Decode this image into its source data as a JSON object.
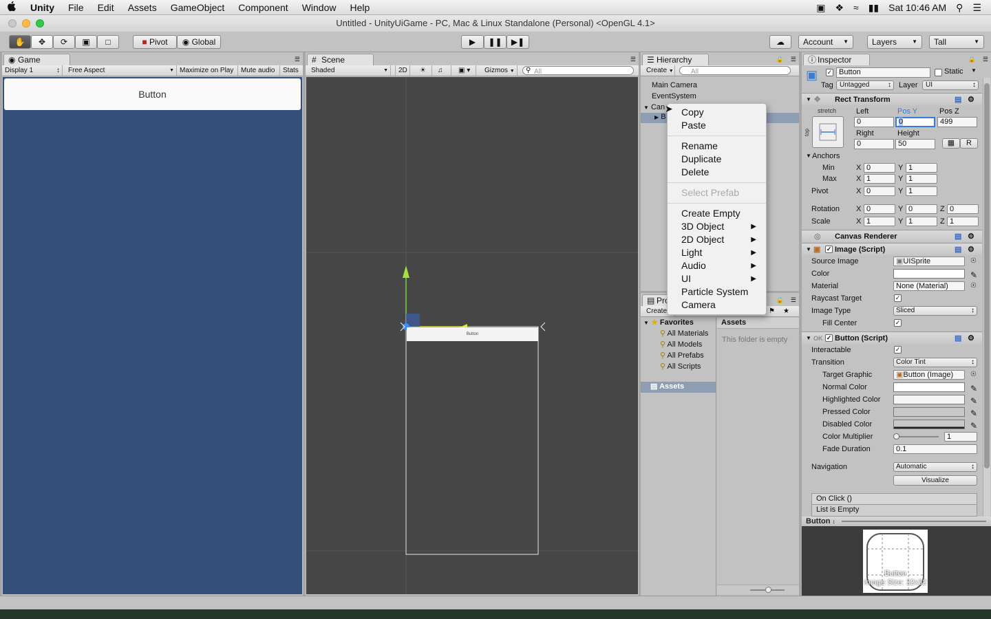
{
  "menubar": {
    "apple": "",
    "items": [
      "Unity",
      "File",
      "Edit",
      "Assets",
      "GameObject",
      "Component",
      "Window",
      "Help"
    ],
    "clock": "Sat 10:46 AM"
  },
  "window": {
    "title": "Untitled - UnityUiGame - PC, Mac & Linux Standalone (Personal) <OpenGL 4.1>"
  },
  "toolbar": {
    "pivot": "Pivot",
    "global": "Global",
    "account": "Account",
    "layers": "Layers",
    "layout": "Tall"
  },
  "game": {
    "tab": "Game",
    "display": "Display 1",
    "aspect": "Free Aspect",
    "maximize": "Maximize on Play",
    "mute": "Mute audio",
    "stats": "Stats",
    "button_label": "Button",
    "canvas_color": "#344f79"
  },
  "scene": {
    "tab": "Scene",
    "shading": "Shaded",
    "mode2d": "2D",
    "gizmos": "Gizmos",
    "search_placeholder": "All",
    "button_label": "Button"
  },
  "hierarchy": {
    "tab": "Hierarchy",
    "create": "Create",
    "search_placeholder": "All",
    "items": [
      "Main Camera",
      "EventSystem",
      "Can",
      "B"
    ]
  },
  "context_menu": {
    "items": [
      {
        "label": "Copy",
        "enabled": true,
        "submenu": false
      },
      {
        "label": "Paste",
        "enabled": true,
        "submenu": false
      },
      {
        "label": "Rename",
        "enabled": true,
        "submenu": false
      },
      {
        "label": "Duplicate",
        "enabled": true,
        "submenu": false
      },
      {
        "label": "Delete",
        "enabled": true,
        "submenu": false
      },
      {
        "label": "Select Prefab",
        "enabled": false,
        "submenu": false
      },
      {
        "label": "Create Empty",
        "enabled": true,
        "submenu": false
      },
      {
        "label": "3D Object",
        "enabled": true,
        "submenu": true
      },
      {
        "label": "2D Object",
        "enabled": true,
        "submenu": true
      },
      {
        "label": "Light",
        "enabled": true,
        "submenu": true
      },
      {
        "label": "Audio",
        "enabled": true,
        "submenu": true
      },
      {
        "label": "UI",
        "enabled": true,
        "submenu": true
      },
      {
        "label": "Particle System",
        "enabled": true,
        "submenu": false
      },
      {
        "label": "Camera",
        "enabled": true,
        "submenu": false
      }
    ]
  },
  "project": {
    "tab": "Pro",
    "create": "Create",
    "favorites": "Favorites",
    "fav_items": [
      "All Materials",
      "All Models",
      "All Prefabs",
      "All Scripts"
    ],
    "assets": "Assets",
    "assets_header": "Assets",
    "empty": "This folder is empty"
  },
  "inspector": {
    "tab": "Inspector",
    "object_name": "Button",
    "static": "Static",
    "tag_label": "Tag",
    "tag": "Untagged",
    "layer_label": "Layer",
    "layer": "UI",
    "rect": {
      "title": "Rect Transform",
      "stretch": "stretch",
      "top": "top",
      "left_label": "Left",
      "posy_label": "Pos Y",
      "posz_label": "Pos Z",
      "left": "0",
      "posy": "0",
      "posz": "499",
      "right_label": "Right",
      "height_label": "Height",
      "right": "0",
      "height": "50",
      "r_btn": "R",
      "anchors": "Anchors",
      "min": "Min",
      "max": "Max",
      "min_x": "0",
      "min_y": "1",
      "max_x": "1",
      "max_y": "1",
      "pivot": "Pivot",
      "pivot_x": "0",
      "pivot_y": "1",
      "rotation": "Rotation",
      "rot_x": "0",
      "rot_y": "0",
      "rot_z": "0",
      "scale": "Scale",
      "scale_x": "1",
      "scale_y": "1",
      "scale_z": "1",
      "x": "X",
      "y": "Y",
      "z": "Z"
    },
    "canvas_renderer": "Canvas Renderer",
    "image": {
      "title": "Image (Script)",
      "source_label": "Source Image",
      "source": "UISprite",
      "color_label": "Color",
      "material_label": "Material",
      "material": "None (Material)",
      "raycast_label": "Raycast Target",
      "type_label": "Image Type",
      "type": "Sliced",
      "fill_label": "Fill Center"
    },
    "button": {
      "title": "Button (Script)",
      "interactable_label": "Interactable",
      "transition_label": "Transition",
      "transition": "Color Tint",
      "target_label": "Target Graphic",
      "target": "Button (Image)",
      "normal_label": "Normal Color",
      "highlighted_label": "Highlighted Color",
      "pressed_label": "Pressed Color",
      "disabled_label": "Disabled Color",
      "multiplier_label": "Color Multiplier",
      "multiplier": "1",
      "fade_label": "Fade Duration",
      "fade": "0.1",
      "navigation_label": "Navigation",
      "navigation": "Automatic",
      "visualize": "Visualize",
      "onclick": "On Click ()",
      "list_empty": "List is Empty"
    },
    "preview": {
      "title": "Button",
      "caption_name": "Button",
      "caption_size": "Image Size: 32x32"
    }
  }
}
